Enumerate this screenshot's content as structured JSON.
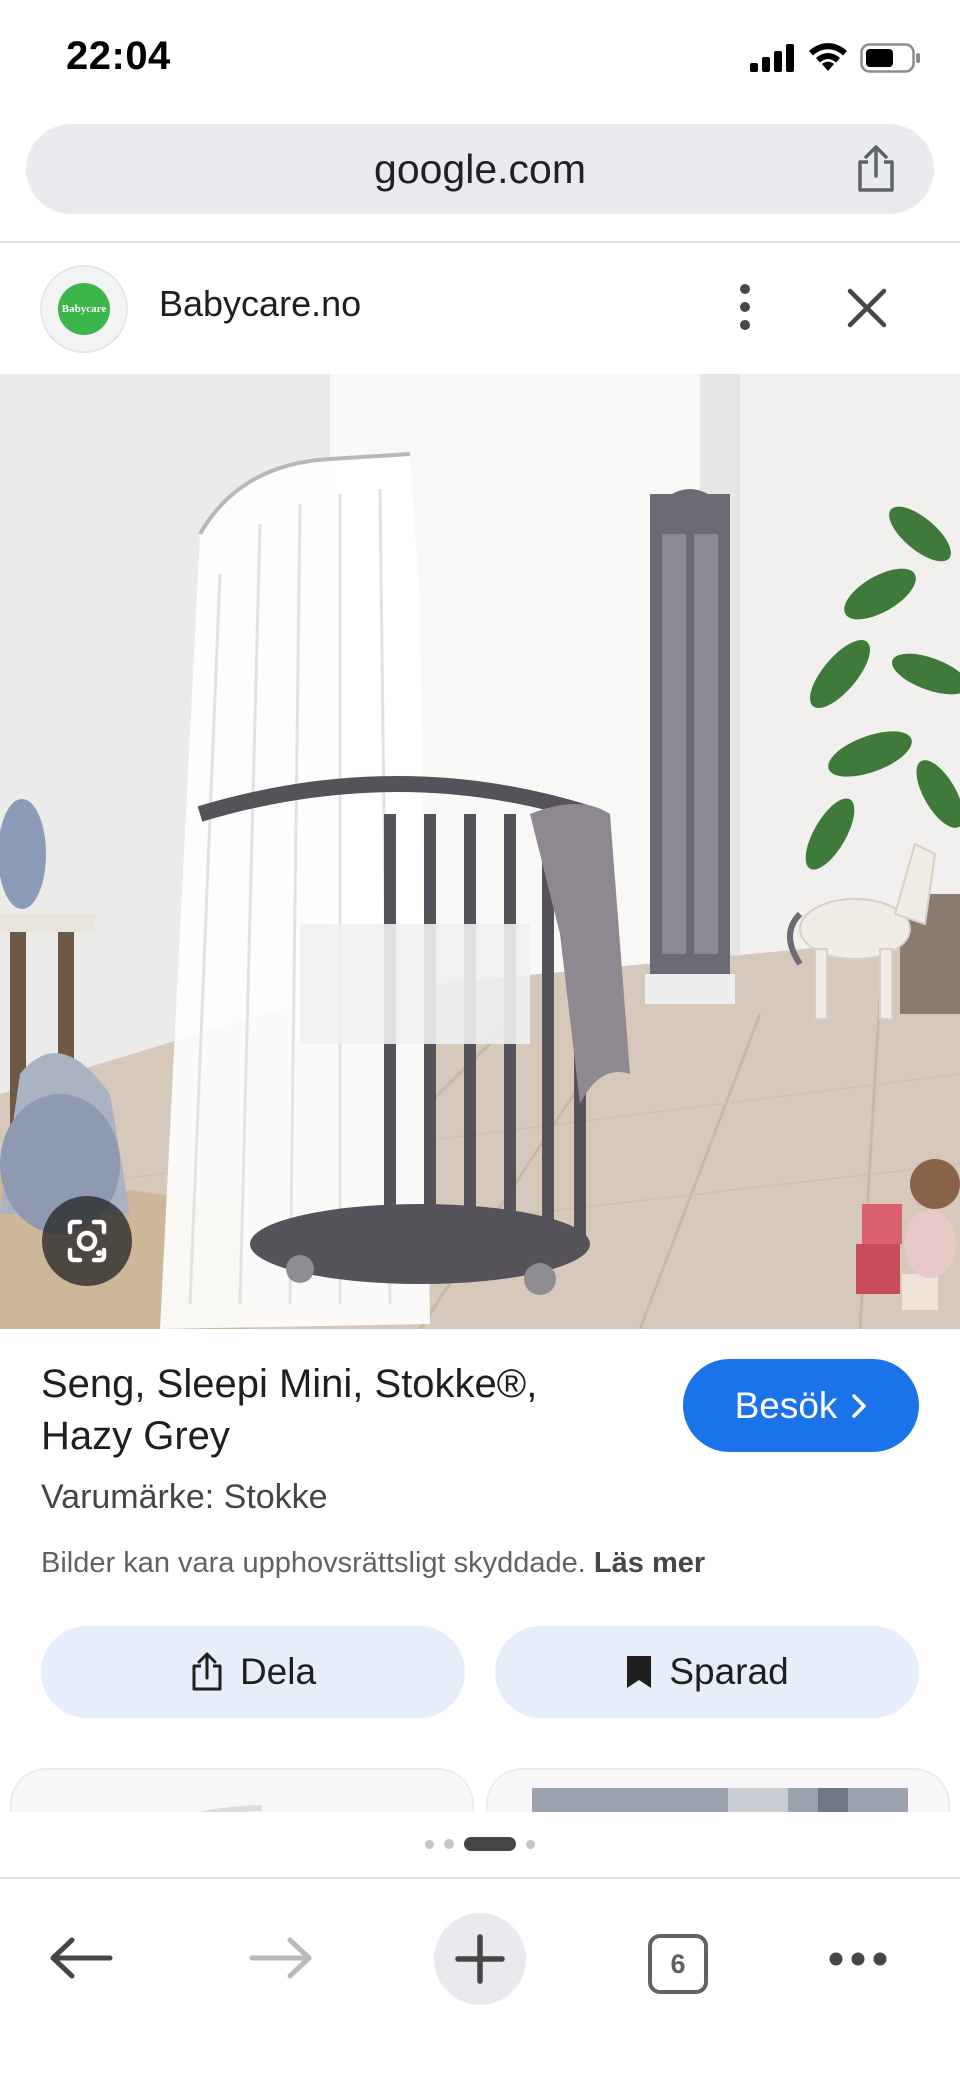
{
  "status_bar": {
    "time": "22:04",
    "icons": [
      "cellular-signal-icon",
      "wifi-icon",
      "battery-icon"
    ]
  },
  "browser": {
    "url": "google.com",
    "share_icon": "share-icon"
  },
  "source": {
    "favicon_text": "Babycare",
    "name": "Babycare.no",
    "more_icon": "vertical-dots-icon",
    "close_icon": "close-icon"
  },
  "hero_image": {
    "description_icon": "google-lens-icon"
  },
  "product": {
    "title_line1": "Seng, Sleepi Mini, Stokke®,",
    "title_line2": "Hazy Grey",
    "visit_label": "Besök",
    "brand": "Varumärke: Stokke",
    "copyright_text": "Bilder kan vara upphovsrättsligt skyddade.",
    "learn_more": "Läs mer"
  },
  "actions": {
    "share_label": "Dela",
    "saved_label": "Sparad"
  },
  "toolbar": {
    "tab_count": "6"
  },
  "colors": {
    "accent_blue": "#1a73e8",
    "action_bg": "#e6eefa",
    "url_bar_bg": "#e9ebee",
    "favicon_green": "#3cb54a"
  }
}
